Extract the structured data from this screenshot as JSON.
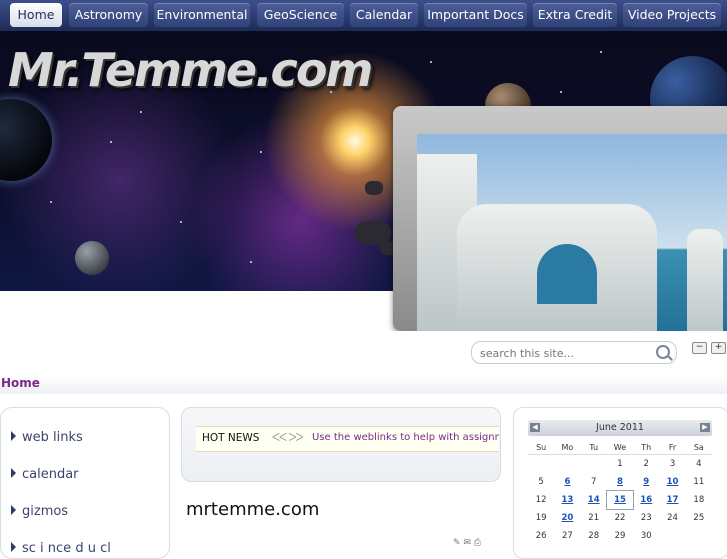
{
  "nav": {
    "items": [
      {
        "label": "Home",
        "active": true
      },
      {
        "label": "Astronomy"
      },
      {
        "label": "Environmental"
      },
      {
        "label": "GeoScience"
      },
      {
        "label": "Calendar"
      },
      {
        "label": "Important Docs"
      },
      {
        "label": "Extra Credit"
      },
      {
        "label": "Video Projects"
      }
    ]
  },
  "banner": {
    "logo_text": "Mr.Temme.com"
  },
  "search": {
    "placeholder": "search this site...",
    "icon": "magnifier-icon"
  },
  "breadcrumb": {
    "current": "Home"
  },
  "sidebar": {
    "items": [
      {
        "label": "web links"
      },
      {
        "label": "calendar"
      },
      {
        "label": "gizmos"
      },
      {
        "label": "sc i  nce d    u  cl"
      }
    ]
  },
  "hotnews": {
    "label": "HOT NEWS",
    "arrows": "ᐸᐸ ᐳᐳ",
    "message": "Use the weblinks to help with assignments"
  },
  "site": {
    "title": "mrtemme.com"
  },
  "calendar": {
    "month": "June 2011",
    "weekdays": [
      "Su",
      "Mo",
      "Tu",
      "We",
      "Th",
      "Fr",
      "Sa"
    ],
    "weeks": [
      [
        "",
        "",
        "",
        "1",
        "2",
        "3",
        "4"
      ],
      [
        "5",
        "6",
        "7",
        "8",
        "9",
        "10",
        "11"
      ],
      [
        "12",
        "13",
        "14",
        "15",
        "16",
        "17",
        "18"
      ],
      [
        "19",
        "20",
        "21",
        "22",
        "23",
        "24",
        "25"
      ],
      [
        "26",
        "27",
        "28",
        "29",
        "30",
        "",
        ""
      ]
    ],
    "linked_days": [
      "6",
      "8",
      "9",
      "10",
      "13",
      "14",
      "15",
      "16",
      "17",
      "20"
    ],
    "today": "15"
  },
  "colors": {
    "nav_bg": "#2a3a6d",
    "accent": "#7a2a8a",
    "link": "#1a52b8"
  }
}
